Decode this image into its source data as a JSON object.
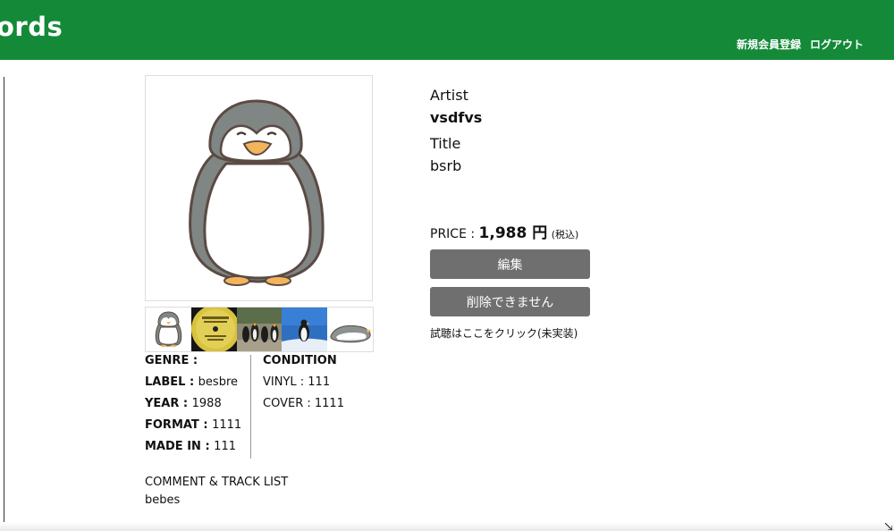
{
  "header": {
    "brand": "ords",
    "nav": [
      "新規会員登録",
      "ログアウト"
    ],
    "color": "#148a39"
  },
  "product": {
    "artist_label": "Artist",
    "artist": "vsdfvs",
    "title_label": "Title",
    "title": "bsrb",
    "price_label": "PRICE : ",
    "price": "1,988 円",
    "tax_note": "(税込)",
    "edit_button": "編集",
    "delete_button": "削除できません",
    "listen_text": "試聴はここをクリック(未実装)"
  },
  "images": {
    "main": "penguin-illustration",
    "thumbnails": [
      "penguin-illustration",
      "vinyl-record-label",
      "penguin-colony-photo",
      "penguin-snow-photo",
      "penguin-sliding-illustration"
    ]
  },
  "specs": {
    "genre_label": "GENRE :",
    "genre": "",
    "label_label": "LABEL : ",
    "label": "besbre",
    "year_label": "YEAR : ",
    "year": "1988",
    "format_label": "FORMAT : ",
    "format": "1111",
    "made_in_label": "MADE IN : ",
    "made_in": "111",
    "condition_label": "CONDITION",
    "vinyl_label": "VINYL : ",
    "vinyl": "111",
    "cover_label": "COVER : ",
    "cover": "1111"
  },
  "comment": {
    "label": "COMMENT & TRACK LIST",
    "text": "bebes"
  }
}
